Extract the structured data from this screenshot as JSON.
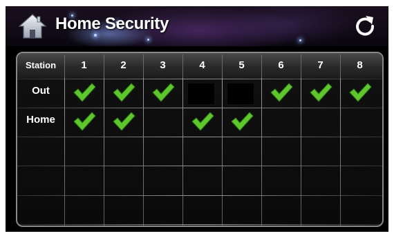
{
  "header": {
    "title": "Home Security",
    "home_icon": "home-icon",
    "refresh_icon": "refresh-icon"
  },
  "grid": {
    "corner_label": "Station",
    "stations": [
      "1",
      "2",
      "3",
      "4",
      "5",
      "6",
      "7",
      "8"
    ],
    "rows": [
      {
        "label": "Out",
        "enabled": [
          true,
          true,
          true,
          false,
          false,
          true,
          true,
          true
        ]
      },
      {
        "label": "Home",
        "enabled": [
          true,
          true,
          false,
          true,
          true,
          false,
          false,
          false
        ]
      },
      {
        "label": "",
        "enabled": [
          false,
          false,
          false,
          false,
          false,
          false,
          false,
          false
        ]
      },
      {
        "label": "",
        "enabled": [
          false,
          false,
          false,
          false,
          false,
          false,
          false,
          false
        ]
      },
      {
        "label": "",
        "enabled": [
          false,
          false,
          false,
          false,
          false,
          false,
          false,
          false
        ]
      }
    ],
    "check_icon": "check-icon",
    "check_color": "#5cc82a"
  }
}
